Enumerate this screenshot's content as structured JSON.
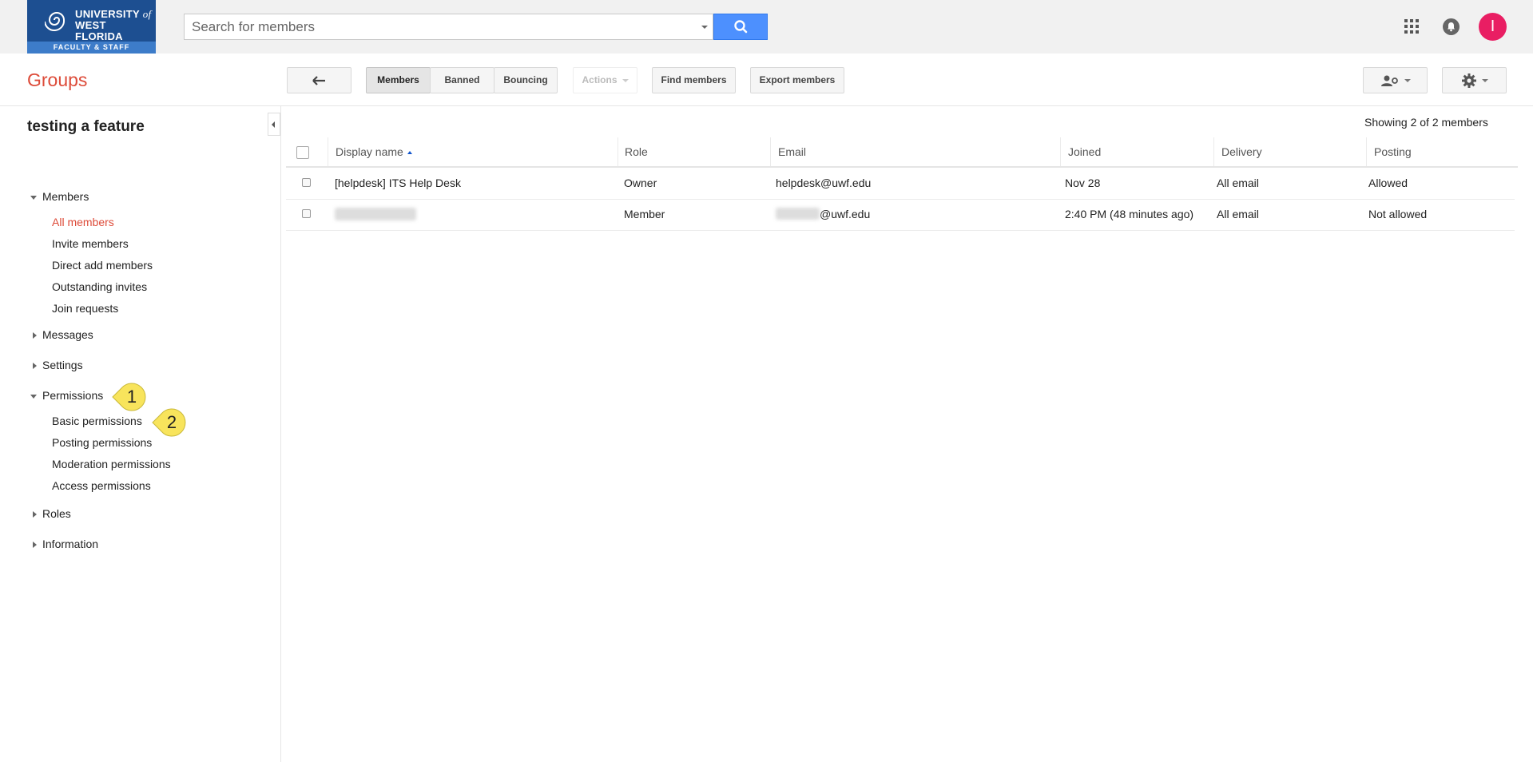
{
  "header": {
    "logo": {
      "line1": "UNIVERSITY",
      "line1_suffix": "of",
      "line2": "WEST FLORIDA",
      "strip": "FACULTY & STAFF"
    },
    "search_placeholder": "Search for members",
    "avatar_initial": "I"
  },
  "app_title": "Groups",
  "toolbar": {
    "members": "Members",
    "banned": "Banned",
    "bouncing": "Bouncing",
    "actions": "Actions",
    "find_members": "Find members",
    "export_members": "Export members"
  },
  "sidebar": {
    "group_name": "testing a feature",
    "sections": {
      "members": "Members",
      "messages": "Messages",
      "settings": "Settings",
      "permissions": "Permissions",
      "roles": "Roles",
      "information": "Information"
    },
    "members_items": [
      "All members",
      "Invite members",
      "Direct add members",
      "Outstanding invites",
      "Join requests"
    ],
    "permissions_items": [
      "Basic permissions",
      "Posting permissions",
      "Moderation permissions",
      "Access permissions"
    ]
  },
  "callouts": [
    "1",
    "2"
  ],
  "table": {
    "showing": "Showing 2 of 2 members",
    "columns": [
      "Display name",
      "Role",
      "Email",
      "Joined",
      "Delivery",
      "Posting"
    ],
    "rows": [
      {
        "name": "[helpdesk] ITS Help Desk",
        "role": "Owner",
        "email": "helpdesk@uwf.edu",
        "joined": "Nov 28",
        "delivery": "All email",
        "posting": "Allowed"
      },
      {
        "name": "",
        "role": "Member",
        "email": "@uwf.edu",
        "joined": "2:40 PM (48 minutes ago)",
        "delivery": "All email",
        "posting": "Not allowed"
      }
    ]
  },
  "colors": {
    "brand_red": "#dd4b39",
    "search_blue": "#4d90fe",
    "logo_blue": "#1d4f91",
    "avatar_pink": "#e91e63",
    "callout_yellow": "#f8e45c"
  }
}
